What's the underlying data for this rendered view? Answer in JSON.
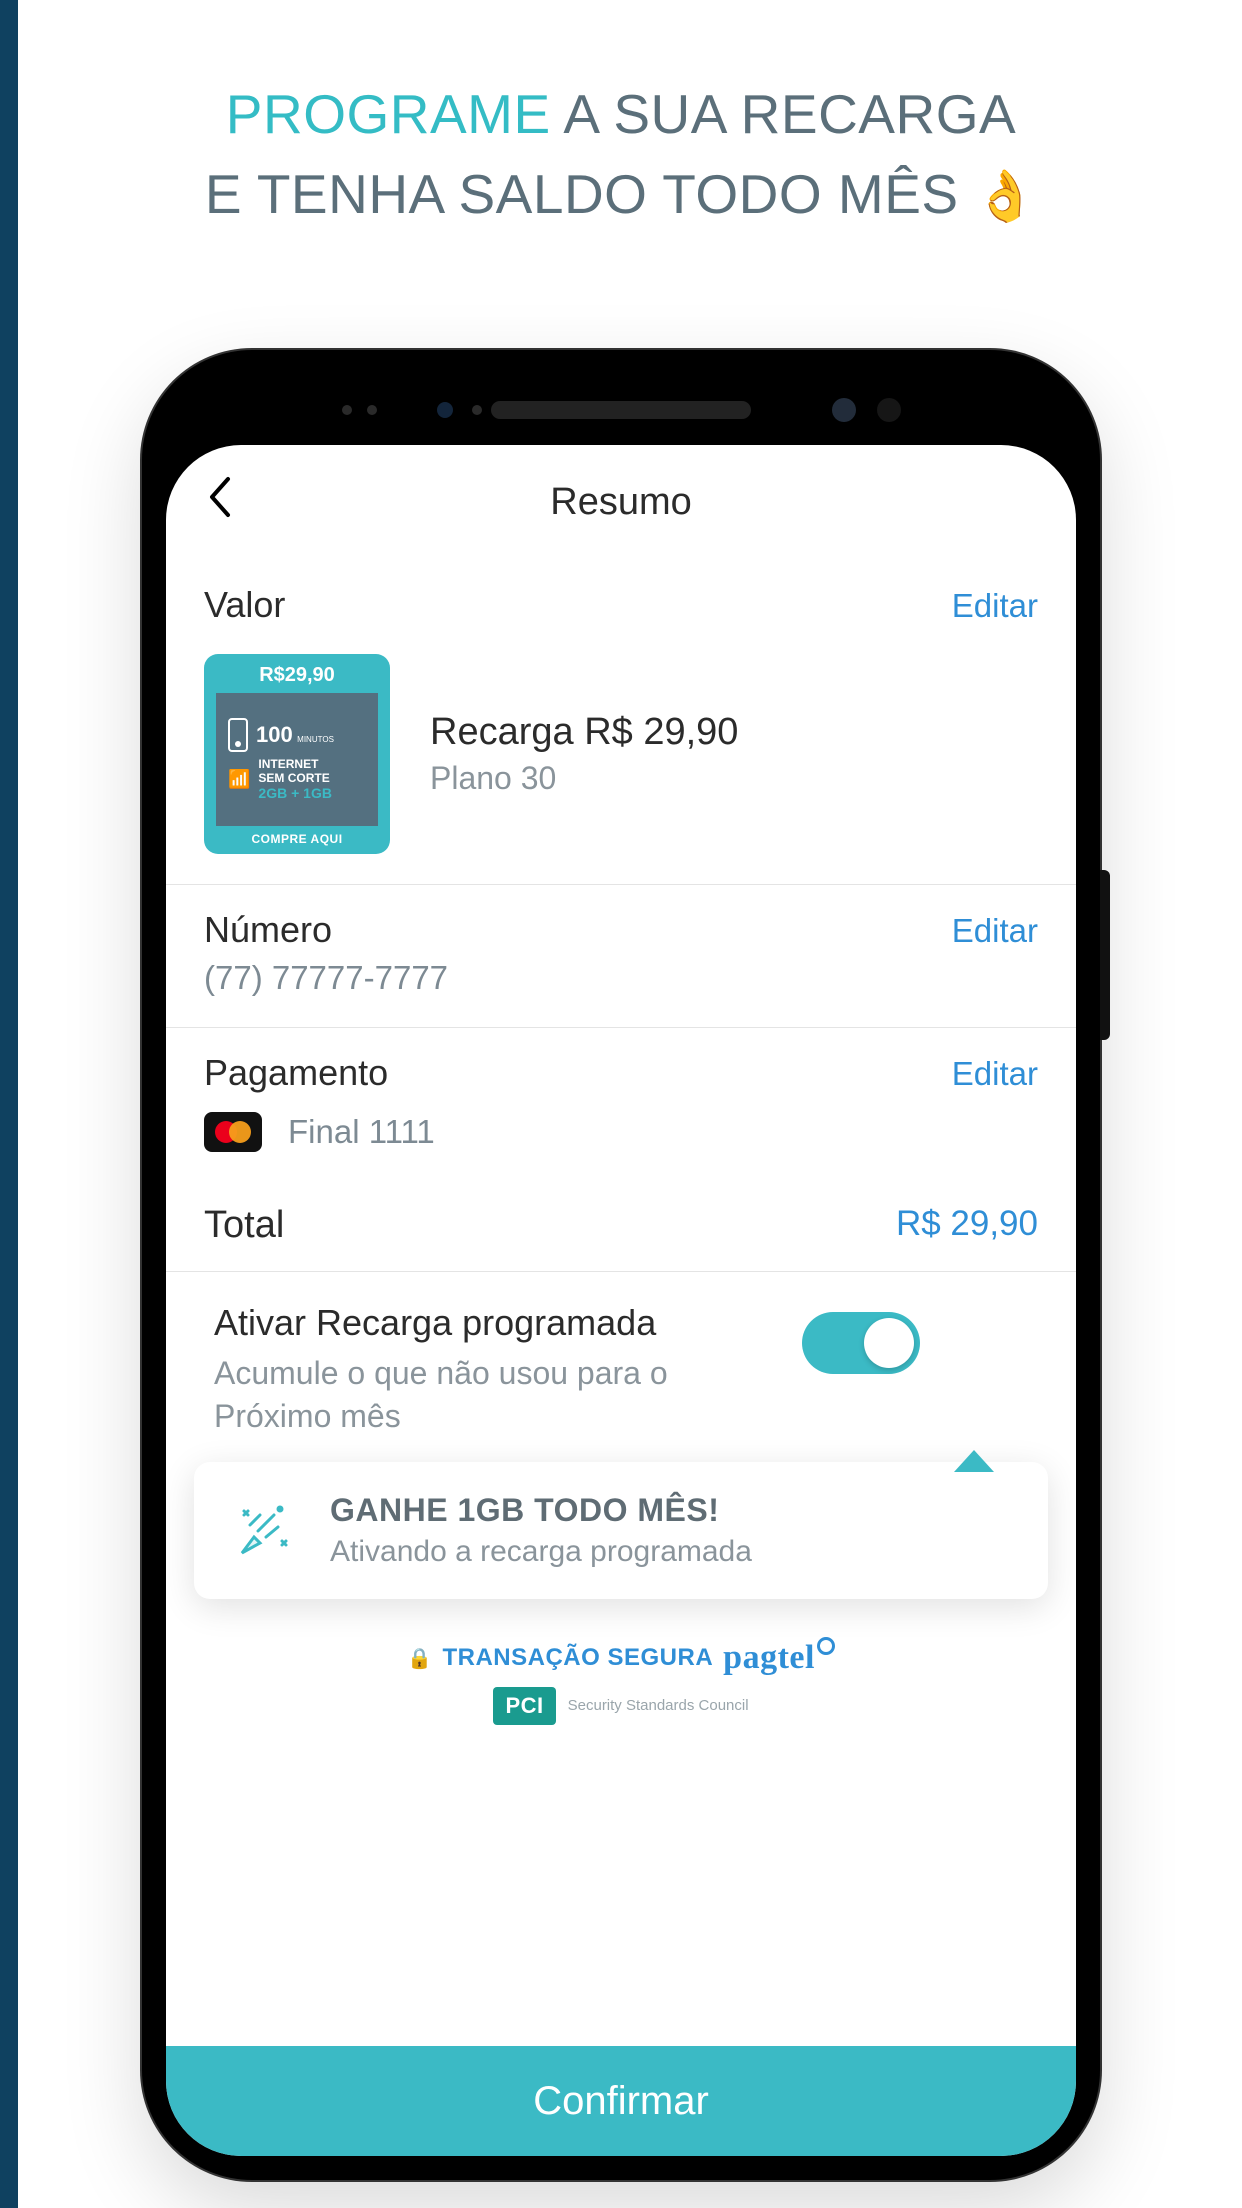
{
  "promo": {
    "accent": "PROGRAME",
    "line1_rest": " A SUA RECARGA",
    "line2": "E TENHA SALDO TODO MÊS ",
    "emoji": "👌"
  },
  "header": {
    "title": "Resumo"
  },
  "valor": {
    "label": "Valor",
    "edit": "Editar",
    "title": "Recarga R$ 29,90",
    "subtitle": "Plano 30",
    "card": {
      "price": "R$29,90",
      "minutes_num": "100",
      "minutes_unit": "MINUTOS",
      "internet1": "INTERNET",
      "internet2": "SEM CORTE",
      "gb": "2GB + 1GB",
      "footer": "COMPRE AQUI"
    }
  },
  "numero": {
    "label": "Número",
    "edit": "Editar",
    "value": "(77) 77777-7777"
  },
  "pagamento": {
    "label": "Pagamento",
    "edit": "Editar",
    "last": "Final 1111"
  },
  "total": {
    "label": "Total",
    "value": "R$ 29,90"
  },
  "toggle": {
    "title": "Ativar Recarga programada",
    "subtitle": "Acumule o que não usou para o Próximo mês",
    "on": true
  },
  "tip": {
    "title": "GANHE 1GB TODO MÊS!",
    "subtitle": "Ativando a recarga programada"
  },
  "trust": {
    "secure": "TRANSAÇÃO SEGURA",
    "brand": "pagtel",
    "pci": "PCI",
    "pci_sub": "Security Standards Council"
  },
  "confirm": "Confirmar"
}
